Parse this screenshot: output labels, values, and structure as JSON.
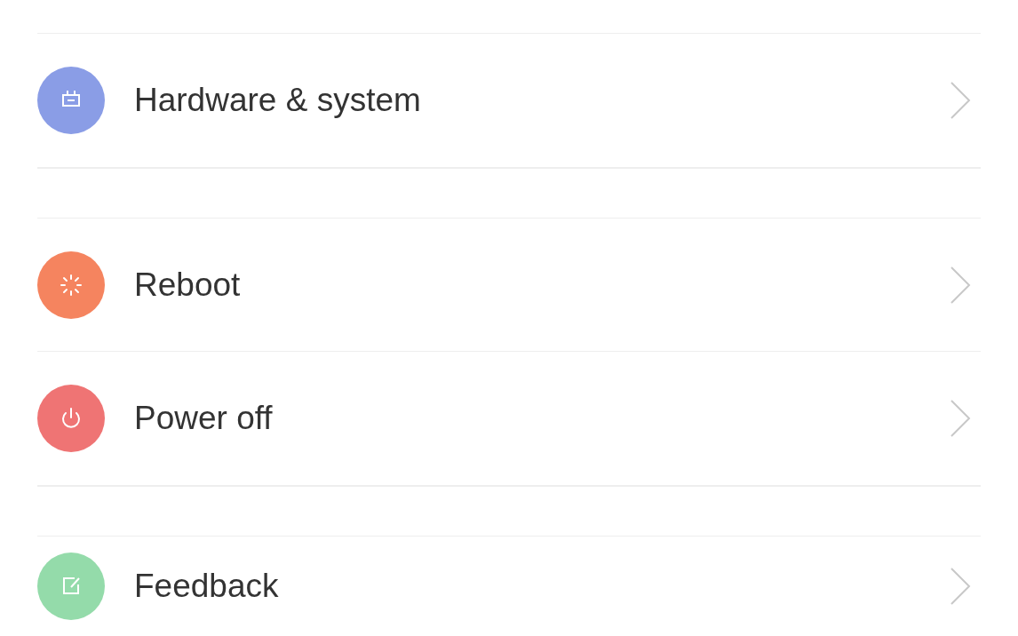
{
  "groups": [
    {
      "items": [
        {
          "label": "Hardware & system",
          "kind": "hardware",
          "color": "#8a9de6"
        }
      ]
    },
    {
      "items": [
        {
          "label": "Reboot",
          "kind": "reboot",
          "color": "#f5845f"
        },
        {
          "label": "Power off",
          "kind": "power",
          "color": "#ef7474"
        }
      ]
    },
    {
      "items": [
        {
          "label": "Feedback",
          "kind": "feedback",
          "color": "#94dbaa"
        }
      ]
    }
  ]
}
